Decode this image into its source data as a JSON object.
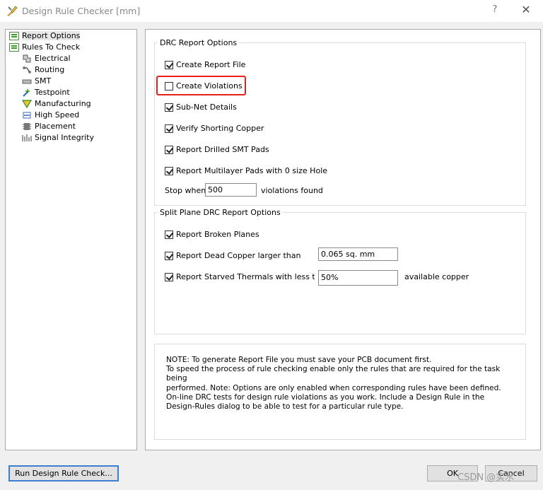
{
  "window": {
    "title": "Design Rule Checker [mm]",
    "help_label": "?",
    "close_label": "✕"
  },
  "tree": {
    "items": [
      {
        "label": "Report Options",
        "icon": "folder-icon"
      },
      {
        "label": "Rules To Check",
        "icon": "folder-icon"
      },
      {
        "label": "Electrical",
        "icon": "electrical-icon"
      },
      {
        "label": "Routing",
        "icon": "routing-icon"
      },
      {
        "label": "SMT",
        "icon": "smt-icon"
      },
      {
        "label": "Testpoint",
        "icon": "testpoint-icon"
      },
      {
        "label": "Manufacturing",
        "icon": "manufacturing-icon"
      },
      {
        "label": "High Speed",
        "icon": "high-speed-icon"
      },
      {
        "label": "Placement",
        "icon": "placement-icon"
      },
      {
        "label": "Signal Integrity",
        "icon": "signal-integrity-icon"
      }
    ]
  },
  "drc": {
    "title": "DRC Report Options",
    "create_report_file": "Create Report File",
    "create_violations": "Create Violations",
    "sub_net_details": "Sub-Net Details",
    "verify_shorting_copper": "Verify Shorting Copper",
    "report_drilled_smt": "Report Drilled SMT Pads",
    "report_multilayer": "Report Multilayer Pads with 0 size Hole",
    "stop_when": "Stop when",
    "stop_value": "500",
    "violations_found": "violations found"
  },
  "split": {
    "title": "Split Plane DRC Report Options",
    "broken_planes": "Report Broken Planes",
    "dead_copper": "Report Dead Copper larger than",
    "dead_copper_value": "0.065 sq. mm",
    "starved_thermals": "Report Starved Thermals with less thar",
    "starved_value": "50%",
    "available_copper": "available copper"
  },
  "note": {
    "lines": [
      "NOTE: To generate Report File you must save your PCB document first.",
      "To speed the process of rule checking enable only the rules that are required for the task being",
      "performed.  Note: Options are only enabled when corresponding rules have been defined.",
      "On-line DRC tests for design rule violations as you work. Include a Design Rule in the",
      "Design-Rules dialog to be able to test for a particular rule  type."
    ]
  },
  "buttons": {
    "run": "Run Design Rule Check...",
    "ok": "OK",
    "cancel": "Cancel"
  },
  "watermark": "CSDN @实水"
}
